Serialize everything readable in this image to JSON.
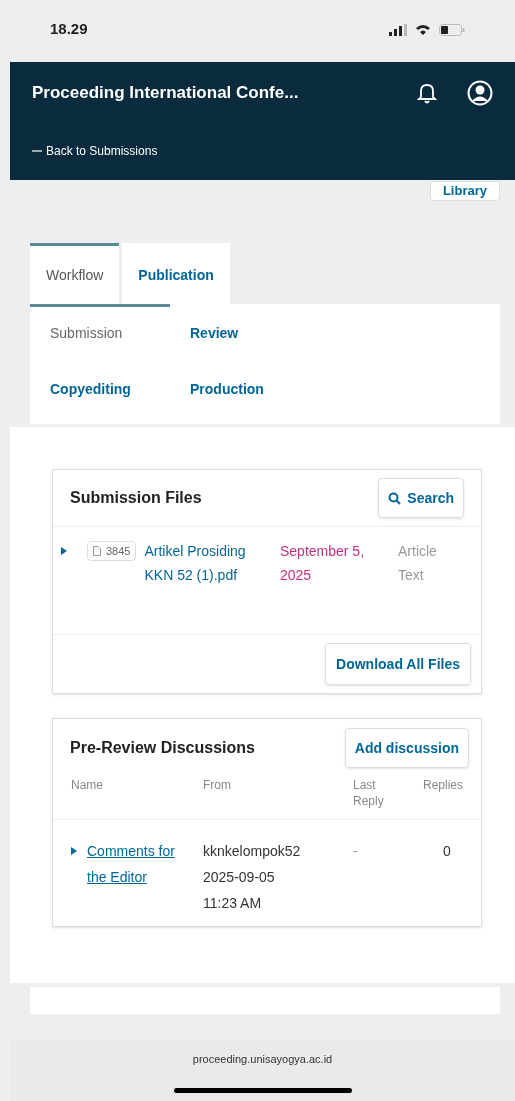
{
  "status_bar": {
    "time": "18.29"
  },
  "header": {
    "title": "Proceeding International Confe...",
    "back_link": "Back to Submissions"
  },
  "library_button": "Library",
  "tabs": [
    {
      "label": "Workflow",
      "selected": true
    },
    {
      "label": "Publication",
      "selected": false
    }
  ],
  "stage_tabs": [
    {
      "label": "Submission",
      "selected": true
    },
    {
      "label": "Review",
      "selected": false
    },
    {
      "label": "Copyediting",
      "selected": false
    },
    {
      "label": "Production",
      "selected": false
    }
  ],
  "submission_files": {
    "title": "Submission Files",
    "search_button": "Search",
    "files": [
      {
        "id": "3845",
        "name": "Artikel Prosiding KKN 52 (1).pdf",
        "date": "September 5, 2025",
        "type": "Article Text"
      }
    ],
    "download_button": "Download All Files"
  },
  "discussions": {
    "title": "Pre-Review Discussions",
    "add_button": "Add discussion",
    "columns": [
      "Name",
      "From",
      "Last Reply",
      "Replies"
    ],
    "rows": [
      {
        "name": "Comments for the Editor",
        "from": "kknkelompok52",
        "date": "2025-09-05",
        "time": "11:23 AM",
        "last_reply": "-",
        "replies": "0"
      }
    ]
  },
  "browser": {
    "url": "proceeding.unisayogya.ac.id"
  }
}
